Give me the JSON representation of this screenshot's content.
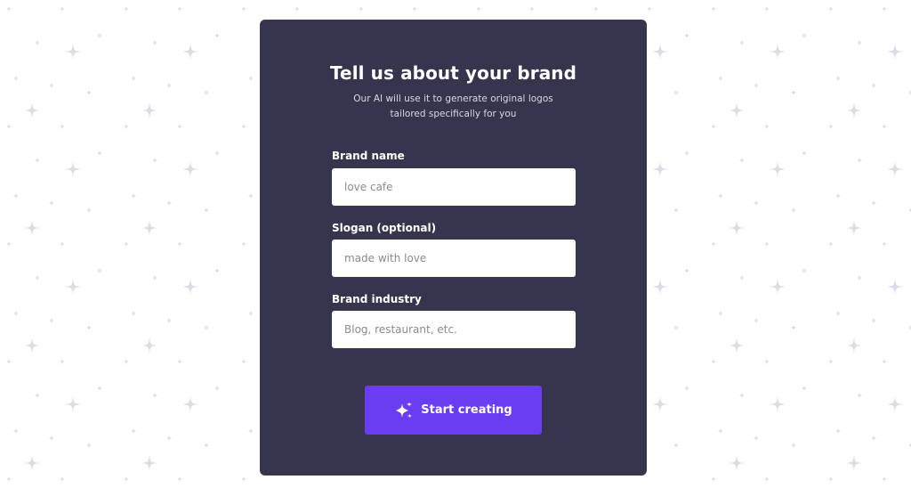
{
  "form": {
    "title": "Tell us about your brand",
    "subtitle": "Our AI will use it to generate original logos tailored specifically for you",
    "brand_name": {
      "label": "Brand name",
      "placeholder": "love cafe",
      "value": ""
    },
    "slogan": {
      "label": "Slogan (optional)",
      "placeholder": "made with love",
      "value": ""
    },
    "industry": {
      "label": "Brand industry",
      "placeholder": "Blog, restaurant, etc.",
      "value": ""
    },
    "submit_label": "Start creating",
    "submit_icon": "sparkles-icon"
  },
  "colors": {
    "card_background": "#37344d",
    "accent": "#6b3df2",
    "page_background": "#ffffff",
    "sparkle_pattern": "#dcdce4"
  },
  "background": {
    "pattern_icon": "sparkle-icon"
  }
}
